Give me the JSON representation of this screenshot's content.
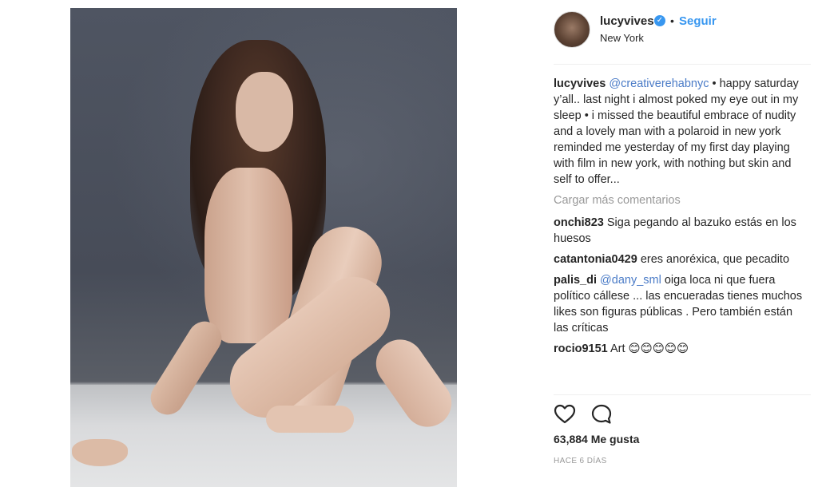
{
  "post": {
    "image_alt": "photo",
    "header": {
      "username": "lucyvives",
      "verified_icon": "verified-badge-icon",
      "separator": "•",
      "follow_label": "Seguir",
      "location": "New York"
    },
    "caption": {
      "username": "lucyvives",
      "mention": "@creativerehabnyc",
      "text": " • happy saturday y’all.. last night i almost poked my eye out in my sleep • i missed the beautiful embrace of nudity and a lovely man with a polaroid in new york reminded me yesterday of my first day playing with film in new york, with nothing but skin and self to offer..."
    },
    "load_more_label": "Cargar más comentarios",
    "comments": [
      {
        "username": "onchi823",
        "mention": "",
        "text": "Siga pegando al bazuko estás en los huesos"
      },
      {
        "username": "catantonia0429",
        "mention": "",
        "text": "eres anoréxica, que pecadito"
      },
      {
        "username": "palis_di",
        "mention": "@dany_sml",
        "text": " oiga loca ni que fuera político cállese ... las encueradas tienes muchos likes son figuras públicas . Pero también están las críticas"
      },
      {
        "username": "rocio9151",
        "mention": "",
        "text": "Art 😊😊😊😊😊"
      }
    ],
    "actions": {
      "like_icon": "heart-icon",
      "comment_icon": "comment-bubble-icon"
    },
    "likes_text": "63,884 Me gusta",
    "time_text": "HACE 6 DÍAS"
  }
}
